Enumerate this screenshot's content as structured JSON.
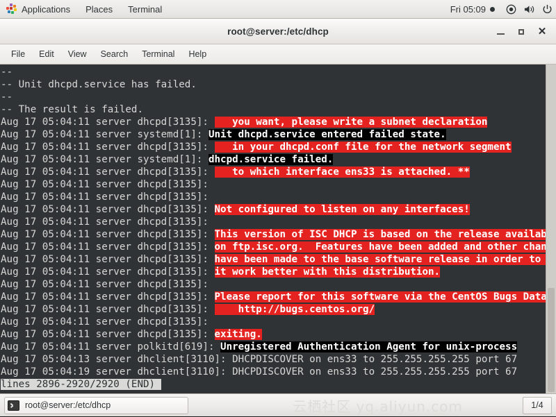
{
  "topbar": {
    "apps_label": "Applications",
    "places_label": "Places",
    "terminal_label": "Terminal",
    "clock": "Fri 05:09",
    "icons": [
      "app-grid-icon",
      "recording-dot-icon",
      "network-icon",
      "volume-icon",
      "power-icon"
    ]
  },
  "window": {
    "title": "root@server:/etc/dhcp",
    "minimize_label": "_",
    "maximize_label": "□",
    "close_label": "✕",
    "menu": [
      "File",
      "Edit",
      "View",
      "Search",
      "Terminal",
      "Help"
    ]
  },
  "colors": {
    "terminal_bg": "#2f3336",
    "highlight_red": "#e42320",
    "highlight_black": "#000000",
    "text_fg": "#d8d9d6"
  },
  "terminal": {
    "prefix_dhcpd": "Aug 17 05:04:11 server dhcpd[3135]: ",
    "prefix_systemd": "Aug 17 05:04:11 server systemd[1]: ",
    "lines": [
      {
        "segments": [
          {
            "text": "--",
            "style": "plain"
          }
        ]
      },
      {
        "segments": [
          {
            "text": "-- Unit dhcpd.service has failed.",
            "style": "plain"
          }
        ]
      },
      {
        "segments": [
          {
            "text": "--",
            "style": "plain"
          }
        ]
      },
      {
        "segments": [
          {
            "text": "-- The result is failed.",
            "style": "plain"
          }
        ]
      },
      {
        "segments": [
          {
            "text": "Aug 17 05:04:11 server dhcpd[3135]: ",
            "style": "plain"
          },
          {
            "text": "   you want, please write a subnet declaration",
            "style": "hl-red"
          }
        ]
      },
      {
        "segments": [
          {
            "text": "Aug 17 05:04:11 server systemd[1]: ",
            "style": "plain"
          },
          {
            "text": "Unit dhcpd.service entered failed state.",
            "style": "hl-black"
          }
        ]
      },
      {
        "segments": [
          {
            "text": "Aug 17 05:04:11 server dhcpd[3135]: ",
            "style": "plain"
          },
          {
            "text": "   in your dhcpd.conf file for the network segment",
            "style": "hl-red"
          }
        ]
      },
      {
        "segments": [
          {
            "text": "Aug 17 05:04:11 server systemd[1]: ",
            "style": "plain"
          },
          {
            "text": "dhcpd.service failed.",
            "style": "hl-black"
          }
        ]
      },
      {
        "segments": [
          {
            "text": "Aug 17 05:04:11 server dhcpd[3135]: ",
            "style": "plain"
          },
          {
            "text": "   to which interface ens33 is attached. **",
            "style": "hl-red"
          }
        ]
      },
      {
        "segments": [
          {
            "text": "Aug 17 05:04:11 server dhcpd[3135]: ",
            "style": "plain"
          }
        ]
      },
      {
        "segments": [
          {
            "text": "Aug 17 05:04:11 server dhcpd[3135]: ",
            "style": "plain"
          }
        ]
      },
      {
        "segments": [
          {
            "text": "Aug 17 05:04:11 server dhcpd[3135]: ",
            "style": "plain"
          },
          {
            "text": "Not configured to listen on any interfaces!",
            "style": "hl-red"
          }
        ]
      },
      {
        "segments": [
          {
            "text": "Aug 17 05:04:11 server dhcpd[3135]: ",
            "style": "plain"
          }
        ]
      },
      {
        "segments": [
          {
            "text": "Aug 17 05:04:11 server dhcpd[3135]: ",
            "style": "plain"
          },
          {
            "text": "This version of ISC DHCP is based on the release available",
            "style": "hl-red"
          }
        ]
      },
      {
        "segments": [
          {
            "text": "Aug 17 05:04:11 server dhcpd[3135]: ",
            "style": "plain"
          },
          {
            "text": "on ftp.isc.org.  Features have been added and other changes",
            "style": "hl-red"
          }
        ]
      },
      {
        "segments": [
          {
            "text": "Aug 17 05:04:11 server dhcpd[3135]: ",
            "style": "plain"
          },
          {
            "text": "have been made to the base software release in order to make",
            "style": "hl-red"
          }
        ]
      },
      {
        "segments": [
          {
            "text": "Aug 17 05:04:11 server dhcpd[3135]: ",
            "style": "plain"
          },
          {
            "text": "it work better with this distribution.",
            "style": "hl-red"
          }
        ]
      },
      {
        "segments": [
          {
            "text": "Aug 17 05:04:11 server dhcpd[3135]: ",
            "style": "plain"
          }
        ]
      },
      {
        "segments": [
          {
            "text": "Aug 17 05:04:11 server dhcpd[3135]: ",
            "style": "plain"
          },
          {
            "text": "Please report for this software via the CentOS Bugs Database:",
            "style": "hl-red"
          }
        ]
      },
      {
        "segments": [
          {
            "text": "Aug 17 05:04:11 server dhcpd[3135]: ",
            "style": "plain"
          },
          {
            "text": "    http://bugs.centos.org/",
            "style": "hl-red"
          }
        ]
      },
      {
        "segments": [
          {
            "text": "Aug 17 05:04:11 server dhcpd[3135]: ",
            "style": "plain"
          }
        ]
      },
      {
        "segments": [
          {
            "text": "Aug 17 05:04:11 server dhcpd[3135]: ",
            "style": "plain"
          },
          {
            "text": "exiting.",
            "style": "hl-red"
          }
        ]
      },
      {
        "segments": [
          {
            "text": "Aug 17 05:04:11 server polkitd[619]: ",
            "style": "plain"
          },
          {
            "text": "Unregistered Authentication Agent for unix-process",
            "style": "hl-black"
          }
        ]
      },
      {
        "segments": [
          {
            "text": "Aug 17 05:04:13 server dhclient[3110]: DHCPDISCOVER on ens33 to 255.255.255.255 port 67",
            "style": "plain"
          }
        ]
      },
      {
        "segments": [
          {
            "text": "Aug 17 05:04:19 server dhclient[3110]: DHCPDISCOVER on ens33 to 255.255.255.255 port 67",
            "style": "plain"
          }
        ]
      },
      {
        "segments": [
          {
            "text": "lines 2896-2920/2920 (END)",
            "style": "inv"
          },
          {
            "text": " ",
            "style": "cursorblk"
          }
        ]
      }
    ]
  },
  "taskbar": {
    "task_label": "root@server:/etc/dhcp",
    "watermark": "云栖社区 yq.aliyun.com",
    "workspace": "1/4"
  }
}
